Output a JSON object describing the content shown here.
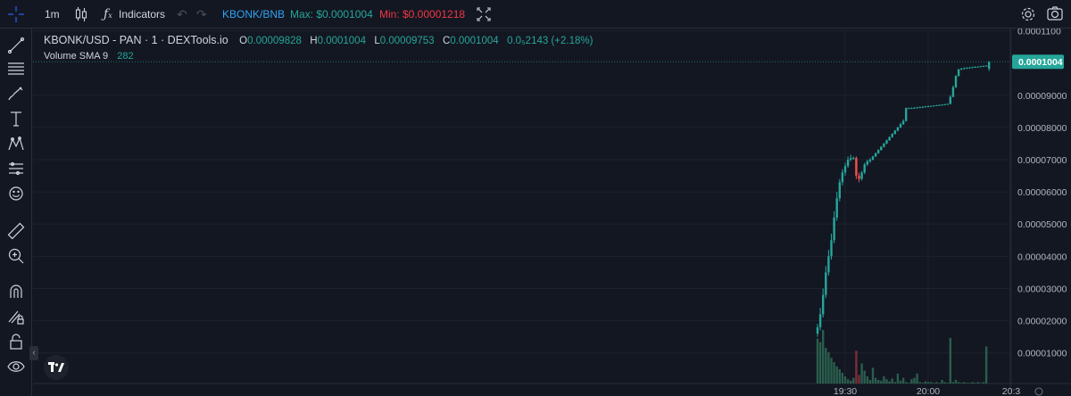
{
  "toolbar": {
    "interval": "1m",
    "indicators_label": "Indicators",
    "pair_link": "KBONK/BNB",
    "max_label": "Max: $0.0001004",
    "min_label": "Min: $0.00001218"
  },
  "legend": {
    "symbol": "KBONK/USD - PAN · 1 · DEXTools.io",
    "o_label": "O",
    "o_value": "0.00009828",
    "h_label": "H",
    "h_value": "0.0001004",
    "l_label": "L",
    "l_value": "0.00009753",
    "c_label": "C",
    "c_value": "0.0001004",
    "change": "0.0₅2143 (+2.18%)",
    "volume_label": "Volume SMA 9",
    "volume_value": "282"
  },
  "colors": {
    "background": "#131722",
    "up": "#26a69a",
    "down": "#ef5350",
    "pair_link": "#2ea3f2",
    "max": "#26a69a",
    "min": "#f23645",
    "volume_up": "#2a5e4c",
    "volume_down": "#7a2e38",
    "price_tag": "#26a69a"
  },
  "chart_data": {
    "type": "candlestick",
    "last_price_label": "0.0001004",
    "ylim": [
      5e-07,
      0.0001107
    ],
    "yticks": [
      0.00011,
      0.0001004,
      9e-05,
      8e-05,
      7e-05,
      6e-05,
      5e-05,
      4e-05,
      3e-05,
      2e-05,
      1e-05
    ],
    "ytick_labels": [
      "0.0001100",
      "0.0001004",
      "0.00009000",
      "0.00008000",
      "0.00007000",
      "0.00006000",
      "0.00005000",
      "0.00004000",
      "0.00003000",
      "0.00002000",
      "0.00001000"
    ],
    "xticks": [
      {
        "label": "19:30",
        "bar": 10
      },
      {
        "label": "20:00",
        "bar": 40
      },
      {
        "label": "20:3",
        "bar": 70
      }
    ],
    "candles": [
      [
        1.6e-05,
        1.9e-05,
        1.5e-05,
        1.8e-05
      ],
      [
        1.8e-05,
        2.4e-05,
        1.7e-05,
        2.2e-05
      ],
      [
        2.2e-05,
        3e-05,
        2.1e-05,
        2.8e-05
      ],
      [
        2.8e-05,
        3.7e-05,
        2.7e-05,
        3.5e-05
      ],
      [
        3.5e-05,
        4.2e-05,
        3.4e-05,
        4e-05
      ],
      [
        4e-05,
        4.7e-05,
        3.9e-05,
        4.5e-05
      ],
      [
        4.5e-05,
        5.4e-05,
        4.4e-05,
        5.2e-05
      ],
      [
        5.2e-05,
        6e-05,
        5.1e-05,
        5.8e-05
      ],
      [
        5.8e-05,
        6.4e-05,
        5.7e-05,
        6.3e-05
      ],
      [
        6.3e-05,
        6.7e-05,
        6.2e-05,
        6.6e-05
      ],
      [
        6.6e-05,
        6.9e-05,
        6.5e-05,
        6.8e-05
      ],
      [
        6.8e-05,
        7.1e-05,
        6.75e-05,
        7e-05
      ],
      [
        7e-05,
        7.15e-05,
        6.95e-05,
        7.05e-05
      ],
      [
        7.05e-05,
        7.1e-05,
        7e-05,
        7.05e-05
      ],
      [
        7.05e-05,
        7.1e-05,
        6.4e-05,
        6.5e-05
      ],
      [
        6.5e-05,
        6.6e-05,
        6.3e-05,
        6.4e-05
      ],
      [
        6.4e-05,
        6.65e-05,
        6.35e-05,
        6.6e-05
      ],
      [
        6.6e-05,
        6.9e-05,
        6.55e-05,
        6.85e-05
      ],
      [
        6.85e-05,
        7e-05,
        6.8e-05,
        6.95e-05
      ],
      [
        6.95e-05,
        7.05e-05,
        6.9e-05,
        7e-05
      ],
      [
        7e-05,
        7.12e-05,
        6.98e-05,
        7.1e-05
      ],
      [
        7.1e-05,
        7.22e-05,
        7.08e-05,
        7.2e-05
      ],
      [
        7.2e-05,
        7.32e-05,
        7.18e-05,
        7.3e-05
      ],
      [
        7.3e-05,
        7.42e-05,
        7.28e-05,
        7.4e-05
      ],
      [
        7.4e-05,
        7.52e-05,
        7.38e-05,
        7.5e-05
      ],
      [
        7.5e-05,
        7.62e-05,
        7.48e-05,
        7.6e-05
      ],
      [
        7.6e-05,
        7.72e-05,
        7.58e-05,
        7.7e-05
      ],
      [
        7.7e-05,
        7.82e-05,
        7.68e-05,
        7.8e-05
      ],
      [
        7.8e-05,
        7.92e-05,
        7.78e-05,
        7.9e-05
      ],
      [
        7.9e-05,
        8.02e-05,
        7.88e-05,
        8e-05
      ],
      [
        8e-05,
        8.15e-05,
        7.98e-05,
        8.1e-05
      ],
      [
        8.1e-05,
        8.25e-05,
        8.08e-05,
        8.2e-05
      ],
      [
        8.2e-05,
        8.62e-05,
        8.18e-05,
        8.6e-05
      ],
      [
        8.6e-05,
        8.62e-05,
        8.58e-05,
        8.6e-05
      ],
      [
        8.6e-05,
        8.62e-05,
        8.58e-05,
        8.6e-05
      ],
      [
        8.6e-05,
        8.63e-05,
        8.58e-05,
        8.61e-05
      ],
      [
        8.61e-05,
        8.64e-05,
        8.59e-05,
        8.62e-05
      ],
      [
        8.62e-05,
        8.65e-05,
        8.6e-05,
        8.63e-05
      ],
      [
        8.63e-05,
        8.66e-05,
        8.61e-05,
        8.64e-05
      ],
      [
        8.64e-05,
        8.67e-05,
        8.62e-05,
        8.65e-05
      ],
      [
        8.65e-05,
        8.68e-05,
        8.63e-05,
        8.66e-05
      ],
      [
        8.66e-05,
        8.68e-05,
        8.64e-05,
        8.67e-05
      ],
      [
        8.67e-05,
        8.69e-05,
        8.65e-05,
        8.68e-05
      ],
      [
        8.68e-05,
        8.7e-05,
        8.66e-05,
        8.69e-05
      ],
      [
        8.69e-05,
        8.71e-05,
        8.67e-05,
        8.7e-05
      ],
      [
        8.7e-05,
        8.72e-05,
        8.68e-05,
        8.71e-05
      ],
      [
        8.71e-05,
        8.73e-05,
        8.69e-05,
        8.72e-05
      ],
      [
        8.72e-05,
        8.74e-05,
        8.7e-05,
        8.73e-05
      ],
      [
        8.73e-05,
        9e-05,
        8.71e-05,
        8.95e-05
      ],
      [
        8.95e-05,
        9.3e-05,
        8.93e-05,
        9.25e-05
      ],
      [
        9.25e-05,
        9.62e-05,
        9.22e-05,
        9.6e-05
      ],
      [
        9.6e-05,
        9.82e-05,
        9.58e-05,
        9.8e-05
      ],
      [
        9.8e-05,
        9.85e-05,
        9.78e-05,
        9.82e-05
      ],
      [
        9.82e-05,
        9.86e-05,
        9.8e-05,
        9.84e-05
      ],
      [
        9.84e-05,
        9.87e-05,
        9.82e-05,
        9.85e-05
      ],
      [
        9.85e-05,
        9.88e-05,
        9.83e-05,
        9.86e-05
      ],
      [
        9.86e-05,
        9.89e-05,
        9.84e-05,
        9.87e-05
      ],
      [
        9.87e-05,
        9.9e-05,
        9.85e-05,
        9.88e-05
      ],
      [
        9.88e-05,
        9.9e-05,
        9.86e-05,
        9.89e-05
      ],
      [
        9.89e-05,
        9.91e-05,
        9.87e-05,
        9.9e-05
      ],
      [
        9.9e-05,
        9.92e-05,
        9.88e-05,
        9.91e-05
      ],
      [
        9.91e-05,
        9.93e-05,
        9.89e-05,
        9.92e-05
      ],
      [
        9.82e-05,
        0.0001006,
        9.75e-05,
        0.0001004
      ]
    ],
    "volumes": [
      [
        0.63,
        "up"
      ],
      [
        0.58,
        "up"
      ],
      [
        0.75,
        "up"
      ],
      [
        0.5,
        "up"
      ],
      [
        0.44,
        "up"
      ],
      [
        0.36,
        "up"
      ],
      [
        0.3,
        "up"
      ],
      [
        0.24,
        "up"
      ],
      [
        0.2,
        "up"
      ],
      [
        0.15,
        "up"
      ],
      [
        0.1,
        "up"
      ],
      [
        0.06,
        "up"
      ],
      [
        0.04,
        "up"
      ],
      [
        0.08,
        "up"
      ],
      [
        0.46,
        "down"
      ],
      [
        0.12,
        "down"
      ],
      [
        0.28,
        "up"
      ],
      [
        0.18,
        "up"
      ],
      [
        0.1,
        "up"
      ],
      [
        0.05,
        "up"
      ],
      [
        0.22,
        "up"
      ],
      [
        0.08,
        "up"
      ],
      [
        0.05,
        "up"
      ],
      [
        0.04,
        "up"
      ],
      [
        0.1,
        "up"
      ],
      [
        0.06,
        "up"
      ],
      [
        0.03,
        "up"
      ],
      [
        0.07,
        "up"
      ],
      [
        0.02,
        "up"
      ],
      [
        0.14,
        "up"
      ],
      [
        0.04,
        "up"
      ],
      [
        0.08,
        "up"
      ],
      [
        0.02,
        "up"
      ],
      [
        0.01,
        "up"
      ],
      [
        0.06,
        "up"
      ],
      [
        0.08,
        "up"
      ],
      [
        0.14,
        "up"
      ],
      [
        0.02,
        "up"
      ],
      [
        0.01,
        "up"
      ],
      [
        0.03,
        "up"
      ],
      [
        0.02,
        "up"
      ],
      [
        0.02,
        "up"
      ],
      [
        0.01,
        "up"
      ],
      [
        0.02,
        "up"
      ],
      [
        0.01,
        "up"
      ],
      [
        0.05,
        "up"
      ],
      [
        0.02,
        "up"
      ],
      [
        0.01,
        "up"
      ],
      [
        0.64,
        "up"
      ],
      [
        0.02,
        "up"
      ],
      [
        0.05,
        "up"
      ],
      [
        0.02,
        "up"
      ],
      [
        0.01,
        "up"
      ],
      [
        0.02,
        "up"
      ],
      [
        0.01,
        "up"
      ],
      [
        0.01,
        "up"
      ],
      [
        0.02,
        "up"
      ],
      [
        0.01,
        "up"
      ],
      [
        0.02,
        "up"
      ],
      [
        0.01,
        "up"
      ],
      [
        0.02,
        "up"
      ],
      [
        0.52,
        "up"
      ]
    ]
  },
  "sidebar_icons": [
    "crosshair-icon",
    "trend-line-icon",
    "fib-retracement-icon",
    "brush-icon",
    "text-icon",
    "pattern-icon",
    "prediction-icon",
    "emoji-icon",
    "ruler-icon",
    "zoom-in-icon",
    "magnet-icon",
    "lock-drawing-icon",
    "lock-icon",
    "eye-icon"
  ]
}
